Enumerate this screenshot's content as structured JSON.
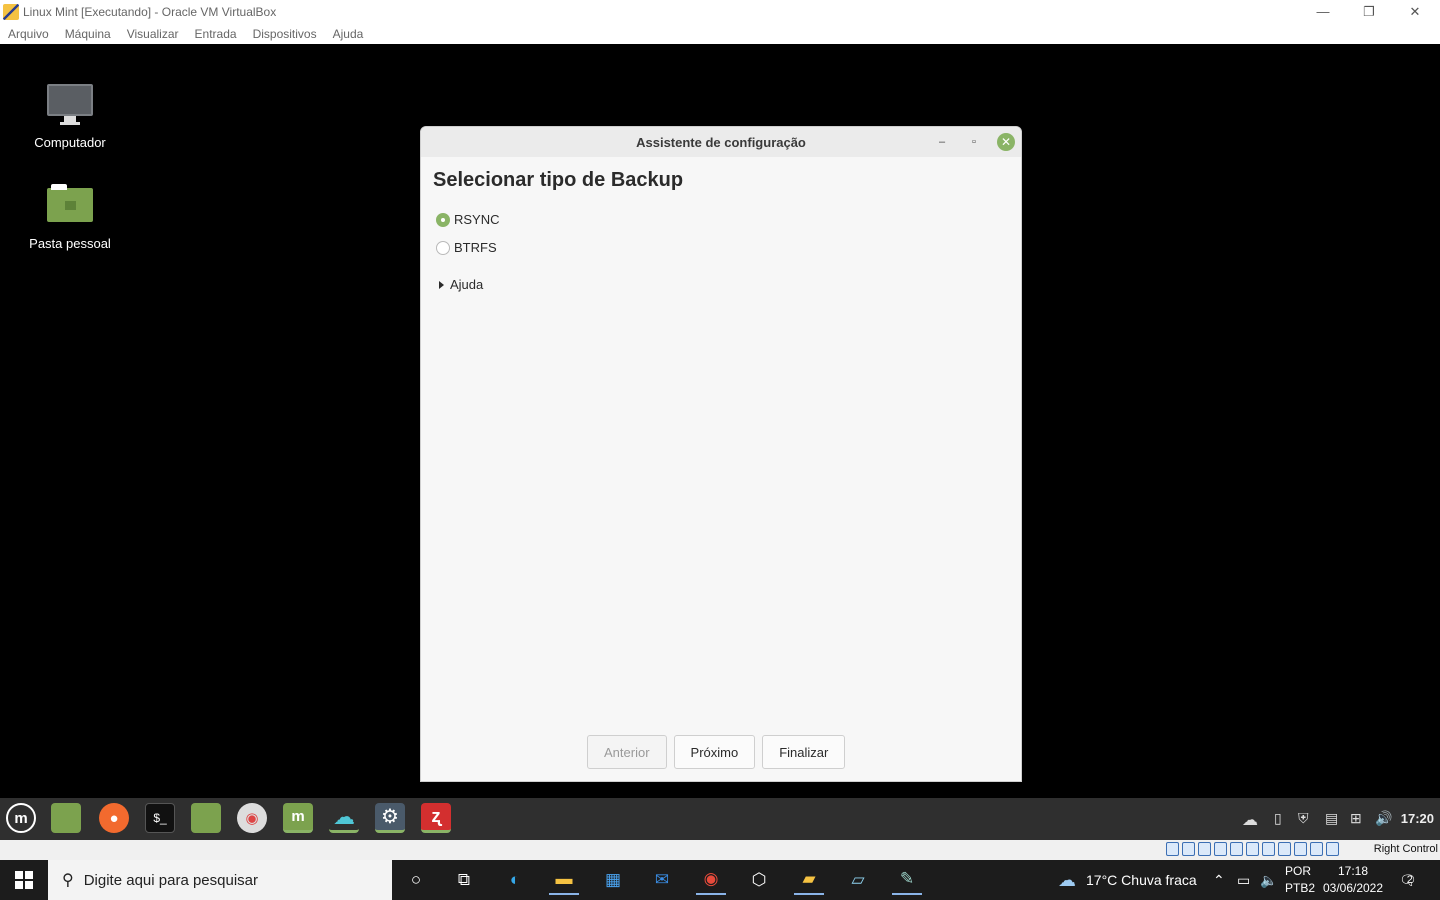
{
  "host": {
    "title": "Linux Mint [Executando] - Oracle VM VirtualBox",
    "menu": [
      "Arquivo",
      "Máquina",
      "Visualizar",
      "Entrada",
      "Dispositivos",
      "Ajuda"
    ],
    "controls": {
      "minimize": "—",
      "restore": "❐",
      "close": "✕"
    },
    "status_key": "Right Control"
  },
  "desktop": {
    "icons": [
      {
        "label": "Computador",
        "icon": "monitor-icon"
      },
      {
        "label": "Pasta pessoal",
        "icon": "home-folder-icon"
      }
    ]
  },
  "dialog": {
    "title": "Assistente de configuração",
    "controls": {
      "minimize": "–",
      "maximize": "▫",
      "close": "✕"
    },
    "heading": "Selecionar tipo de Backup",
    "options": [
      {
        "label": "RSYNC",
        "selected": true
      },
      {
        "label": "BTRFS",
        "selected": false
      }
    ],
    "expander": "Ajuda",
    "buttons": {
      "previous": "Anterior",
      "next": "Próximo",
      "finish": "Finalizar"
    },
    "accent": "#8ab466"
  },
  "mint_panel": {
    "apps": [
      "mint-menu-icon",
      "show-desktop-icon",
      "firefox-icon",
      "terminal-icon",
      "files-icon",
      "chromium-icon",
      "mintupdate-icon",
      "pcloud-icon",
      "settings-icon",
      "timeshift-icon"
    ],
    "clock": "17:20"
  },
  "taskbar": {
    "search_placeholder": "Digite aqui para pesquisar",
    "weather": "17°C  Chuva fraca",
    "lang1": "POR",
    "lang2": "PTB2",
    "time": "17:18",
    "date": "03/06/2022",
    "notifications": "2"
  }
}
